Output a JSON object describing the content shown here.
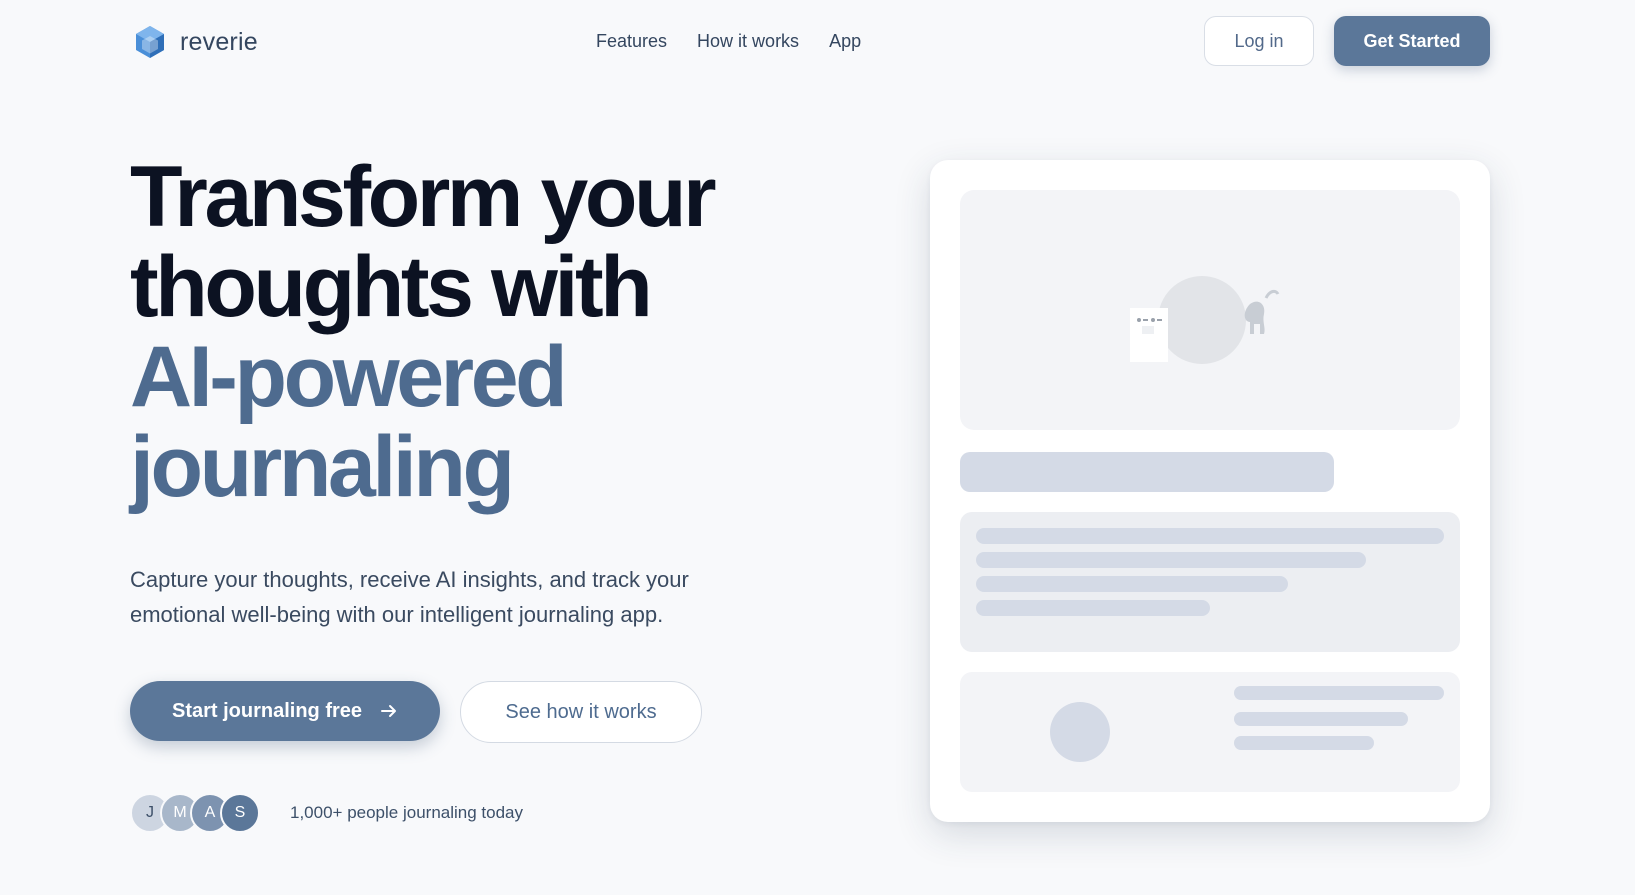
{
  "nav": {
    "brand": "reverie",
    "links": [
      {
        "label": "Features"
      },
      {
        "label": "How it works"
      },
      {
        "label": "App"
      }
    ],
    "login_label": "Log in",
    "get_started_label": "Get Started"
  },
  "hero": {
    "title_line1": "Transform your",
    "title_line2": "thoughts with",
    "title_accent_line1": "AI-powered",
    "title_accent_line2": "journaling",
    "subtitle": "Capture your thoughts, receive AI insights, and track your emotional well-being with our intelligent journaling app.",
    "cta_primary": "Start journaling free",
    "cta_secondary": "See how it works"
  },
  "social_proof": {
    "avatars": [
      {
        "initial": "J",
        "color": "#cdd5e1",
        "text_color": "#3d5069"
      },
      {
        "initial": "M",
        "color": "#a8b7ca",
        "text_color": "#ffffff"
      },
      {
        "initial": "A",
        "color": "#7d93b0",
        "text_color": "#ffffff"
      },
      {
        "initial": "S",
        "color": "#5b7799",
        "text_color": "#ffffff"
      }
    ],
    "text": "1,000+ people journaling today"
  },
  "icons": {
    "logo": "cube-icon",
    "cta_arrow": "arrow-right-icon"
  },
  "colors": {
    "accent": "#5b7799",
    "accent_text": "#4e6b8f",
    "heading": "#0c1222",
    "skeleton": "#d4dae6",
    "background": "#f8f9fb"
  }
}
